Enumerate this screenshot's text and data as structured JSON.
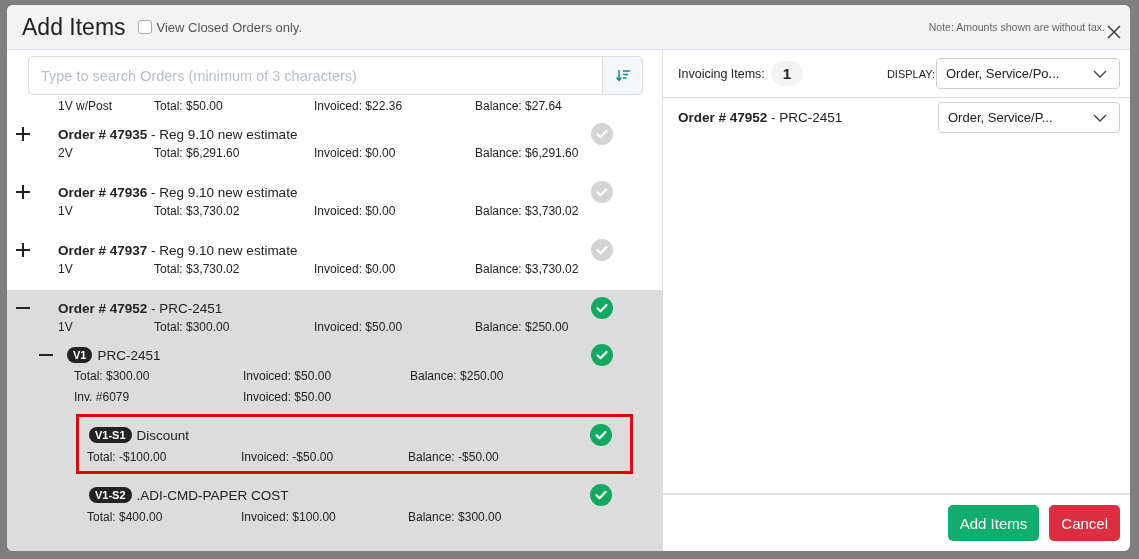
{
  "dialog": {
    "title": "Add Items",
    "closed_only": {
      "label": "View Closed Orders only.",
      "checked": false
    },
    "note": "Note: Amounts shown are without tax."
  },
  "search": {
    "placeholder": "Type to search Orders (minimum of 3 characters)"
  },
  "partial_row": {
    "version": "1V w/Post",
    "total": "Total: $50.00",
    "invoiced": "Invoiced: $22.36",
    "balance": "Balance: $27.64"
  },
  "orders": [
    {
      "number": "Order # 47935",
      "name": " - Reg 9.10 new estimate",
      "expanded": false,
      "selected": false,
      "version": "2V",
      "total": "Total: $6,291.60",
      "invoiced": "Invoiced: $0.00",
      "balance": "Balance: $6,291.60"
    },
    {
      "number": "Order # 47936",
      "name": " - Reg 9.10 new estimate",
      "expanded": false,
      "selected": false,
      "version": "1V",
      "total": "Total: $3,730.02",
      "invoiced": "Invoiced: $0.00",
      "balance": "Balance: $3,730.02"
    },
    {
      "number": "Order # 47937",
      "name": " - Reg 9.10 new estimate",
      "expanded": false,
      "selected": false,
      "version": "1V",
      "total": "Total: $3,730.02",
      "invoiced": "Invoiced: $0.00",
      "balance": "Balance: $3,730.02"
    },
    {
      "number": "Order # 47952",
      "name": " - PRC-2451",
      "expanded": true,
      "selected": true,
      "version": "1V",
      "total": "Total: $300.00",
      "invoiced": "Invoiced: $50.00",
      "balance": "Balance: $250.00",
      "versions": [
        {
          "badge": "V1",
          "name": "PRC-2451",
          "expanded": true,
          "selected": true,
          "total": "Total: $300.00",
          "invoiced": "Invoiced: $50.00",
          "balance": "Balance: $250.00",
          "invoices": [
            {
              "label": "Inv. #6079",
              "invoiced": "Invoiced: $50.00"
            }
          ],
          "services": [
            {
              "badge": "V1-S1",
              "name": "Discount",
              "selected": true,
              "highlighted": true,
              "total": "Total: -$100.00",
              "invoiced": "Invoiced: -$50.00",
              "balance": "Balance: -$50.00"
            },
            {
              "badge": "V1-S2",
              "name": ".ADI-CMD-PAPER COST",
              "selected": true,
              "highlighted": false,
              "total": "Total: $400.00",
              "invoiced": "Invoiced: $100.00",
              "balance": "Balance: $300.00"
            }
          ]
        }
      ]
    }
  ],
  "invoicing": {
    "label": "Invoicing Items:",
    "count": "1",
    "display_label": "DISPLAY:",
    "display_value": "Order, Service/Po...",
    "items": [
      {
        "number": "Order # 47952",
        "name": " - PRC-2451",
        "display": "Order, Service/P..."
      }
    ]
  },
  "buttons": {
    "add": "Add Items",
    "cancel": "Cancel"
  }
}
